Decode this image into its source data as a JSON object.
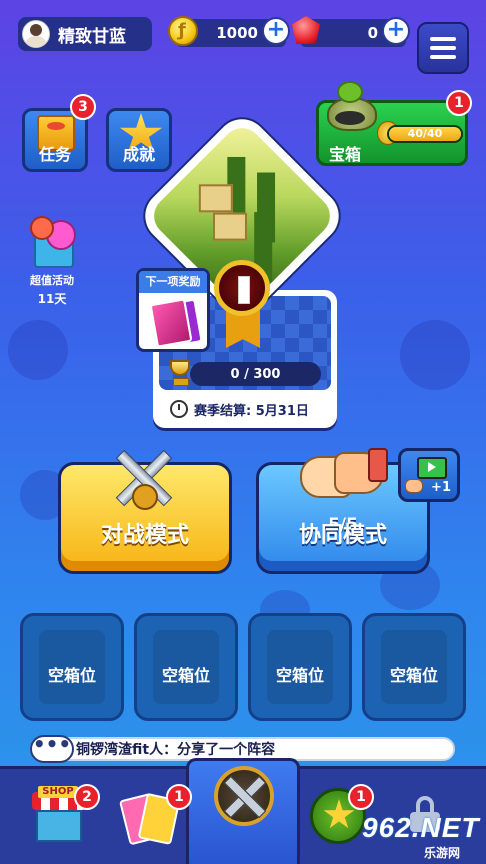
{
  "profile": {
    "name": "精致甘蓝"
  },
  "currency": {
    "coins": "1000",
    "gems": "0"
  },
  "side_buttons": {
    "tasks": {
      "label": "任务",
      "badge": "3"
    },
    "achievements": {
      "label": "成就"
    }
  },
  "chest": {
    "label": "宝箱",
    "badge": "1",
    "progress_text": "40/40",
    "progress": 1.0
  },
  "event": {
    "label": "超值活动",
    "days": "11天"
  },
  "arena": {
    "next_reward_label": "下一项奖励",
    "medal_rank": "I",
    "trophy_progress": "0 / 300",
    "season_end": "赛季结算:  5月31日"
  },
  "modes": {
    "battle": {
      "label": "对战模式"
    },
    "coop": {
      "label": "协同模式",
      "count": "5/5"
    },
    "video_bonus": "+1"
  },
  "slots": [
    {
      "label": "空箱位"
    },
    {
      "label": "空箱位"
    },
    {
      "label": "空箱位"
    },
    {
      "label": "空箱位"
    }
  ],
  "chat": {
    "dots": "•••",
    "message": "铜锣湾渣fit人：分享了一个阵容"
  },
  "nav": {
    "shop": {
      "sign": "SHOP",
      "badge": "2"
    },
    "cards": {
      "badge": "1"
    },
    "rank": {
      "badge": "1"
    }
  },
  "watermark": {
    "logo": "962.NET",
    "sub": "乐游网"
  },
  "colors": {
    "accent": "#3c7ce8",
    "badge": "#e8222d",
    "battle": "#f6b312",
    "coop": "#2e86ea"
  }
}
